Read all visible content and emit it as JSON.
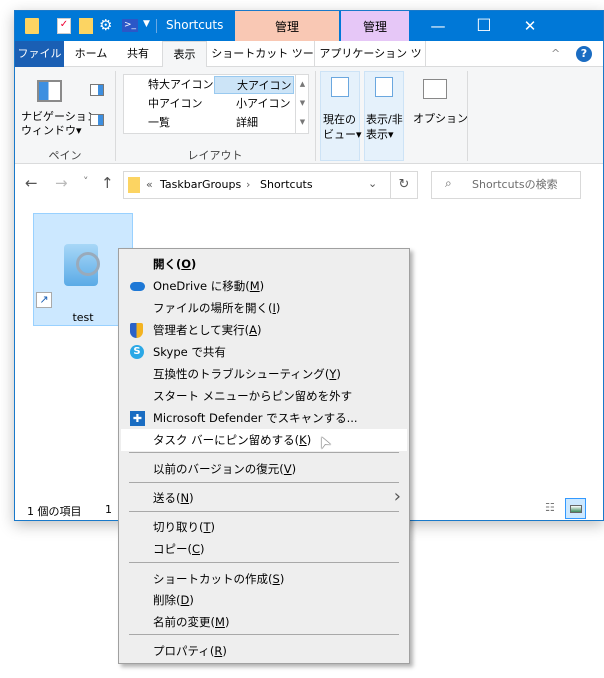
{
  "title_bar": {
    "title": "Shortcuts",
    "context_tab_1": "管理",
    "context_tab_2": "管理",
    "context_tab_1_color": "#f9c8b4",
    "context_tab_2_color": "#e6c7f7",
    "minimize": "—",
    "maximize": "☐",
    "close": "✕"
  },
  "ribbon_tabs": {
    "file": "ファイル",
    "home": "ホーム",
    "share": "共有",
    "view": "表示",
    "shortcut_tools": "ショートカット ツール",
    "app_tools": "アプリケーション ツール"
  },
  "ribbon": {
    "nav_pane_line1": "ナビゲーション",
    "nav_pane_line2": "ウィンドウ▾",
    "pane_group": "ペイン",
    "layout": [
      "特大アイコン",
      "大アイコン",
      "中アイコン",
      "小アイコン",
      "一覧",
      "詳細"
    ],
    "layout_selected": "大アイコン",
    "layout_group": "レイアウト",
    "current_view_1": "現在の",
    "current_view_2": "ビュー▾",
    "show_hide_1": "表示/非",
    "show_hide_2": "表示▾",
    "options": "オプション"
  },
  "nav": {
    "back": "←",
    "forward": "→",
    "recent": "˅",
    "up": "↑",
    "breadcrumb_prefix": "«",
    "crumbs": [
      "TaskbarGroups",
      "Shortcuts"
    ],
    "refresh": "↻",
    "search_placeholder": "Shortcutsの検索"
  },
  "files": [
    {
      "name": "test"
    }
  ],
  "status": {
    "count": "1 個の項目",
    "selected": "1"
  },
  "context_menu": {
    "items": [
      {
        "label": "開く",
        "key": "O",
        "bold": true
      },
      {
        "label": "OneDrive に移動",
        "key": "M",
        "icon": "onedrive-icon"
      },
      {
        "label": "ファイルの場所を開く",
        "key": "I"
      },
      {
        "label": "管理者として実行",
        "key": "A",
        "icon": "uac-shield-icon"
      },
      {
        "label": "Skype で共有",
        "icon": "skype-icon"
      },
      {
        "label": "互換性のトラブルシューティング",
        "key": "Y"
      },
      {
        "label": "スタート メニューからピン留めを外す"
      },
      {
        "label": "Microsoft Defender でスキャンする...",
        "icon": "defender-icon"
      },
      {
        "label": "タスク バーにピン留めする",
        "key": "K",
        "highlighted": true
      },
      {
        "label": "以前のバージョンの復元",
        "key": "V"
      },
      {
        "label": "送る",
        "key": "N",
        "submenu": true
      },
      {
        "label": "切り取り",
        "key": "T"
      },
      {
        "label": "コピー",
        "key": "C"
      },
      {
        "label": "ショートカットの作成",
        "key": "S"
      },
      {
        "label": "削除",
        "key": "D"
      },
      {
        "label": "名前の変更",
        "key": "M"
      },
      {
        "label": "プロパティ",
        "key": "R"
      }
    ]
  }
}
